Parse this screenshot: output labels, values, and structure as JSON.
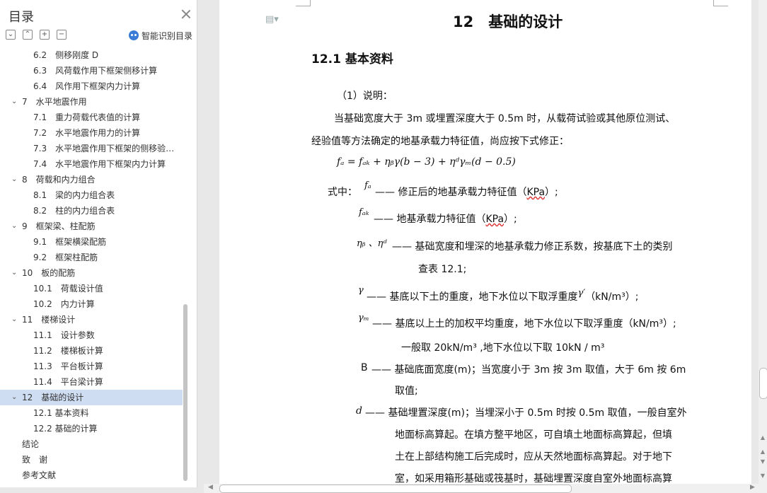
{
  "sidebar": {
    "title": "目录",
    "smart_toc_label": "智能识别目录",
    "tools": [
      "expand-all",
      "collapse-all",
      "add-level",
      "remove-level"
    ],
    "items": [
      {
        "label": "6.2　侧移刚度 D",
        "level": 2,
        "selected": false
      },
      {
        "label": "6.3　风荷载作用下框架侧移计算",
        "level": 2,
        "selected": false
      },
      {
        "label": "6.4　风作用下框架内力计算",
        "level": 2,
        "selected": false
      },
      {
        "label": "7　水平地震作用",
        "level": 1,
        "expanded": true,
        "selected": false
      },
      {
        "label": "7.1　重力荷载代表值的计算",
        "level": 2,
        "selected": false
      },
      {
        "label": "7.2　水平地震作用力的计算",
        "level": 2,
        "selected": false
      },
      {
        "label": "7.3　水平地震作用下框架的侧移验…",
        "level": 2,
        "selected": false
      },
      {
        "label": "7.4　水平地震作用下框架内力计算",
        "level": 2,
        "selected": false
      },
      {
        "label": "8　荷载和内力组合",
        "level": 1,
        "expanded": true,
        "selected": false
      },
      {
        "label": "8.1　梁的内力组合表",
        "level": 2,
        "selected": false
      },
      {
        "label": "8.2　柱的内力组合表",
        "level": 2,
        "selected": false
      },
      {
        "label": "9　框架梁、柱配筋",
        "level": 1,
        "expanded": true,
        "selected": false
      },
      {
        "label": "9.1　框架横梁配筋",
        "level": 2,
        "selected": false
      },
      {
        "label": "9.2　框架柱配筋",
        "level": 2,
        "selected": false
      },
      {
        "label": "10　板的配筋",
        "level": 1,
        "expanded": true,
        "selected": false
      },
      {
        "label": "10.1　荷载设计值",
        "level": 2,
        "selected": false
      },
      {
        "label": "10.2　内力计算",
        "level": 2,
        "selected": false
      },
      {
        "label": "11　楼梯设计",
        "level": 1,
        "expanded": true,
        "selected": false
      },
      {
        "label": "11.1　设计参数",
        "level": 2,
        "selected": false
      },
      {
        "label": "11.2　楼梯板计算",
        "level": 2,
        "selected": false
      },
      {
        "label": "11.3　平台板计算",
        "level": 2,
        "selected": false
      },
      {
        "label": "11.4　平台梁计算",
        "level": 2,
        "selected": false
      },
      {
        "label": "12　基础的设计",
        "level": 1,
        "expanded": true,
        "selected": true
      },
      {
        "label": "12.1 基本资料",
        "level": 2,
        "selected": false
      },
      {
        "label": "12.2 基础的计算",
        "level": 2,
        "selected": false
      },
      {
        "label": "结论",
        "level": 0,
        "selected": false
      },
      {
        "label": "致　谢",
        "level": 0,
        "selected": false
      },
      {
        "label": "参考文献",
        "level": 0,
        "selected": false
      }
    ]
  },
  "doc": {
    "chapter_title": "12　基础的设计",
    "section_title": "12.1 基本资料",
    "p_note": "（1）说明：",
    "p1a": "当基础宽度大于 3m 或埋置深度大于 0.5m 时，从载荷试验或其他原位测试、",
    "p1b": "经验值等方法确定的地基承载力特征值，尚应按下式修正：",
    "formula": "fₐ = fₐₖ + ηᵦγ(b − 3) + ηᵈγₘ(d − 0.5)",
    "where": "式中：",
    "sym_fa": "fₐ",
    "def_fa_1": "—— 修正后的地基承载力特征值（",
    "def_fa_kpa": "KPa",
    "def_fa_2": "）;",
    "sym_fak": "fₐₖ",
    "def_fak_1": "—— 地基承载力特征值（",
    "def_fak_kpa": "KPa",
    "def_fak_2": "）;",
    "sym_eta": "ηᵦ 、ηᵈ",
    "def_eta_a": "—— 基础宽度和埋深的地基承载力修正系数，按基底下土的类别",
    "def_eta_b": "查表 12.1;",
    "sym_gamma": "γ",
    "def_gamma_1": "—— 基底以下土的重度，地下水位以下取浮重度",
    "def_gamma_sym": "γ′",
    "def_gamma_2": "（kN/m³）;",
    "sym_gammam": "γₘ",
    "def_gammam_a": "—— 基底以上土的加权平均重度，地下水位以下取浮重度（kN/m³）;",
    "def_gammam_b": "一般取 20kN/m³ ,地下水位以下取 10kN / m³",
    "sym_b": "B",
    "def_b_a": "—— 基础底面宽度(m)；当宽度小于 3m 按 3m 取值，大于 6m 按 6m",
    "def_b_b": "取值;",
    "sym_d": "d",
    "def_d_a": "—— 基础埋置深度(m)；当埋深小于 0.5m 时按 0.5m 取值，一般自室外",
    "def_d_b": "地面标高算起。在填方整平地区，可自填土地面标高算起，但填",
    "def_d_c": "土在上部结构施工后完成时，应从天然地面标高算起。对于地下",
    "def_d_d": "室，如采用箱形基础或筏基时，基础埋置深度自室外地面标高算"
  }
}
